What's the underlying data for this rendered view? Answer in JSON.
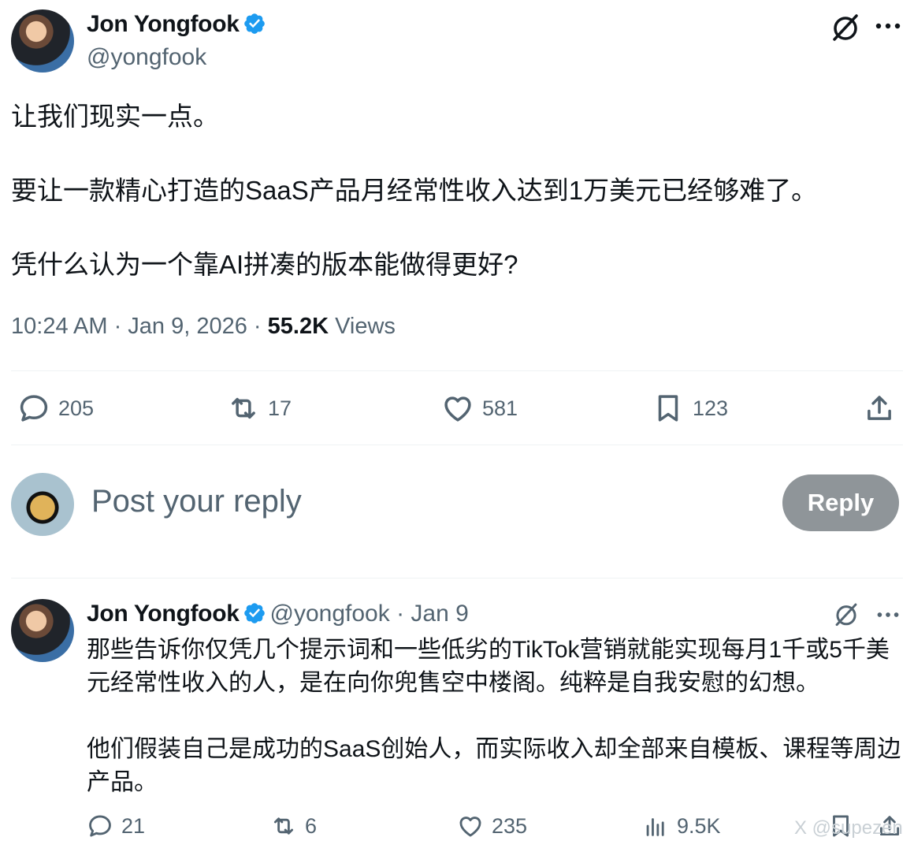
{
  "tweet": {
    "author_name": "Jon Yongfook",
    "author_handle": "@yongfook",
    "text": "让我们现实一点。\n\n要让一款精心打造的SaaS产品月经常性收入达到1万美元已经够难了。\n\n凭什么认为一个靠AI拼凑的版本能做得更好?",
    "time": "10:24 AM · Jan 9, 2026 · ",
    "views_count": "55.2K",
    "views_label": " Views",
    "actions": {
      "replies": "205",
      "reposts": "17",
      "likes": "581",
      "bookmarks": "123"
    }
  },
  "composer": {
    "placeholder": "Post your reply",
    "button_label": "Reply"
  },
  "reply": {
    "author_name": "Jon Yongfook",
    "author_handle": "@yongfook",
    "date": " · Jan 9",
    "text": "那些告诉你仅凭几个提示词和一些低劣的TikTok营销就能实现每月1千或5千美元经常性收入的人，是在向你兜售空中楼阁。纯粹是自我安慰的幻想。\n\n他们假装自己是成功的SaaS创始人，而实际收入却全部来自模板、课程等周边产品。",
    "actions": {
      "replies": "21",
      "reposts": "6",
      "likes": "235",
      "views": "9.5K"
    }
  },
  "watermark": "X @supezen",
  "colors": {
    "verified": "#1d9bf0",
    "secondary_text": "#536471",
    "reply_button": "#8f9599"
  }
}
